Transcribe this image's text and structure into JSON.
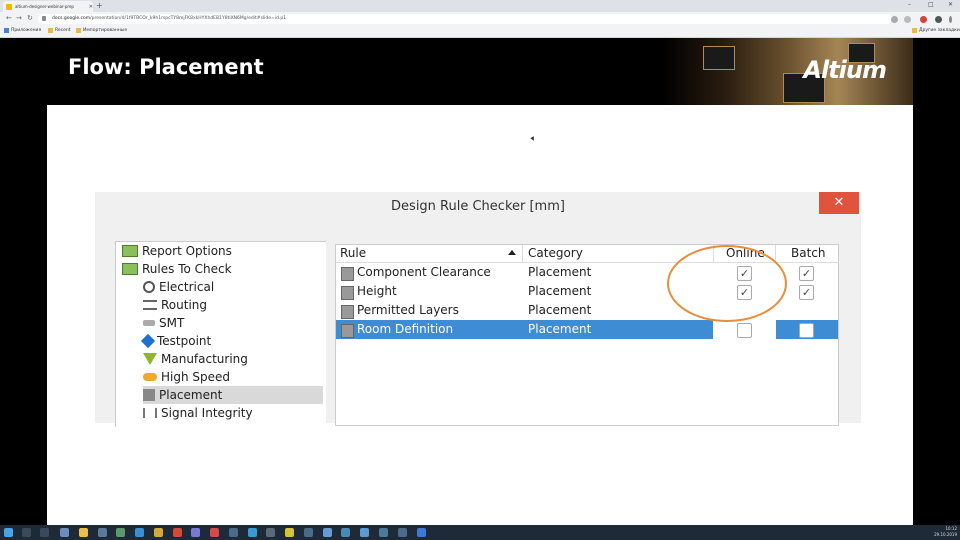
{
  "browser": {
    "tab_title": "altium-designer-webinar-prep",
    "new_tab_symbol": "+",
    "url_domain": "docs.google.com",
    "url_path": "/presentation/d/1f9TBCOr_k9h1rspcTY8mjFK8xkHYXhdEB1Y8tiXN6Mg/edit#slide=id.p1",
    "bookmarks": [
      "Приложения",
      "Recent",
      "Импортированные"
    ],
    "bookmarks_right": "Другие закладки"
  },
  "slide": {
    "title": "Flow: Placement",
    "logo": "Altium"
  },
  "dialog": {
    "title": "Design Rule Checker [mm]",
    "close_symbol": "✕",
    "tree": [
      {
        "label": "Report Options",
        "icon": "folder-icon"
      },
      {
        "label": "Rules To Check",
        "icon": "folder-icon"
      },
      {
        "label": "Electrical",
        "icon": "electrical-icon"
      },
      {
        "label": "Routing",
        "icon": "routing-icon"
      },
      {
        "label": "SMT",
        "icon": "smt-icon"
      },
      {
        "label": "Testpoint",
        "icon": "testpoint-icon"
      },
      {
        "label": "Manufacturing",
        "icon": "manufacturing-icon"
      },
      {
        "label": "High Speed",
        "icon": "high-speed-icon"
      },
      {
        "label": "Placement",
        "icon": "placement-icon"
      },
      {
        "label": "Signal Integrity",
        "icon": "signal-integrity-icon"
      }
    ],
    "columns": {
      "rule": "Rule",
      "category": "Category",
      "online": "Online",
      "batch": "Batch"
    },
    "rows": [
      {
        "rule": "Component Clearance",
        "category": "Placement",
        "online": true,
        "batch": true
      },
      {
        "rule": "Height",
        "category": "Placement",
        "online": true,
        "batch": true
      },
      {
        "rule": "Permitted Layers",
        "category": "Placement",
        "online": false,
        "batch": false
      },
      {
        "rule": "Room Definition",
        "category": "Placement",
        "online": false,
        "batch": false
      }
    ],
    "check_glyph": "✓"
  },
  "taskbar": {
    "time": "10:12",
    "date": "29.10.2019"
  },
  "colors": {
    "accent_selected": "#3d8cd4",
    "close_button": "#e0533d",
    "annotation": "#e88d3a"
  }
}
